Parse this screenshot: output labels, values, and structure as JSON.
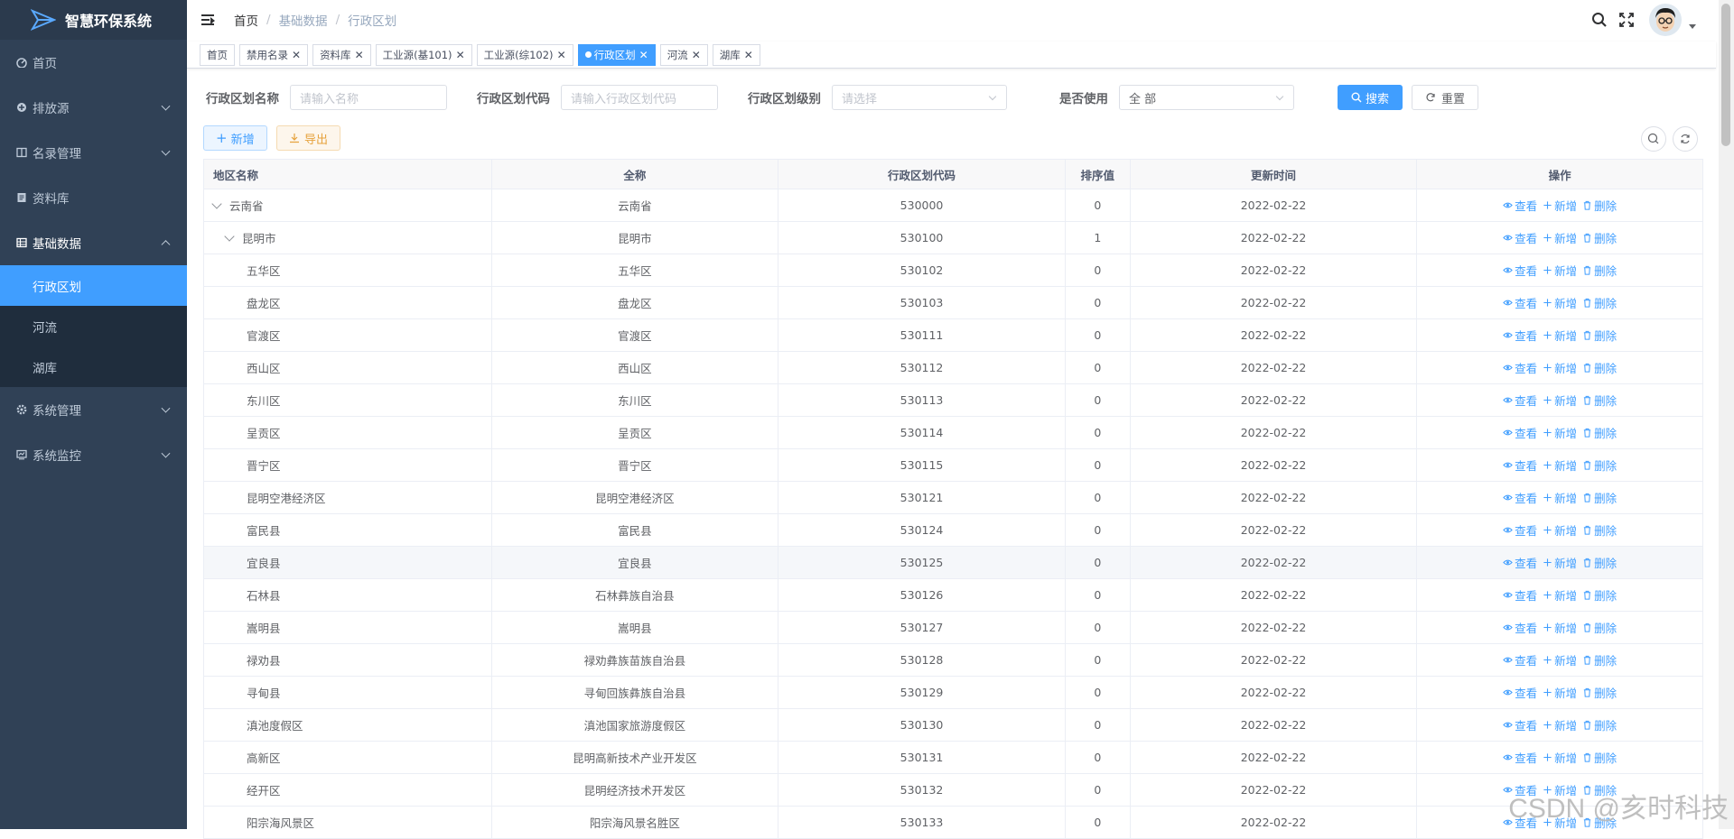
{
  "app": {
    "title": "智慧环保系统"
  },
  "sidebar": {
    "items": [
      {
        "label": "首页",
        "icon": "dashboard-icon"
      },
      {
        "label": "排放源",
        "icon": "emission-icon"
      },
      {
        "label": "名录管理",
        "icon": "directory-icon"
      },
      {
        "label": "资料库",
        "icon": "document-icon"
      },
      {
        "label": "基础数据",
        "icon": "grid-icon"
      },
      {
        "label": "系统管理",
        "icon": "gear-icon"
      },
      {
        "label": "系统监控",
        "icon": "monitor-icon"
      }
    ],
    "sub_items": [
      "行政区划",
      "河流",
      "湖库"
    ]
  },
  "breadcrumb": [
    "首页",
    "基础数据",
    "行政区划"
  ],
  "tags": [
    "首页",
    "禁用名录",
    "资料库",
    "工业源(基101)",
    "工业源(综102)",
    "行政区划",
    "河流",
    "湖库"
  ],
  "form": {
    "name_label": "行政区划名称",
    "name_placeholder": "请输入名称",
    "code_label": "行政区划代码",
    "code_placeholder": "请输入行政区划代码",
    "level_label": "行政区划级别",
    "level_placeholder": "请选择",
    "use_label": "是否使用",
    "use_value": "全 部",
    "search_label": "搜索",
    "reset_label": "重置"
  },
  "toolbar": {
    "add_label": "新增",
    "export_label": "导出"
  },
  "table": {
    "headers": [
      "地区名称",
      "全称",
      "行政区划代码",
      "排序值",
      "更新时间",
      "操作"
    ],
    "ops": [
      "查看",
      "新增",
      "删除"
    ],
    "rows": [
      {
        "name": "云南省",
        "full": "云南省",
        "code": "530000",
        "sort": "0",
        "time": "2022-02-22",
        "level": 0
      },
      {
        "name": "昆明市",
        "full": "昆明市",
        "code": "530100",
        "sort": "1",
        "time": "2022-02-22",
        "level": 1
      },
      {
        "name": "五华区",
        "full": "五华区",
        "code": "530102",
        "sort": "0",
        "time": "2022-02-22",
        "level": 2
      },
      {
        "name": "盘龙区",
        "full": "盘龙区",
        "code": "530103",
        "sort": "0",
        "time": "2022-02-22",
        "level": 2
      },
      {
        "name": "官渡区",
        "full": "官渡区",
        "code": "530111",
        "sort": "0",
        "time": "2022-02-22",
        "level": 2
      },
      {
        "name": "西山区",
        "full": "西山区",
        "code": "530112",
        "sort": "0",
        "time": "2022-02-22",
        "level": 2
      },
      {
        "name": "东川区",
        "full": "东川区",
        "code": "530113",
        "sort": "0",
        "time": "2022-02-22",
        "level": 2
      },
      {
        "name": "呈贡区",
        "full": "呈贡区",
        "code": "530114",
        "sort": "0",
        "time": "2022-02-22",
        "level": 2
      },
      {
        "name": "晋宁区",
        "full": "晋宁区",
        "code": "530115",
        "sort": "0",
        "time": "2022-02-22",
        "level": 2
      },
      {
        "name": "昆明空港经济区",
        "full": "昆明空港经济区",
        "code": "530121",
        "sort": "0",
        "time": "2022-02-22",
        "level": 2
      },
      {
        "name": "富民县",
        "full": "富民县",
        "code": "530124",
        "sort": "0",
        "time": "2022-02-22",
        "level": 2
      },
      {
        "name": "宜良县",
        "full": "宜良县",
        "code": "530125",
        "sort": "0",
        "time": "2022-02-22",
        "level": 2
      },
      {
        "name": "石林县",
        "full": "石林彝族自治县",
        "code": "530126",
        "sort": "0",
        "time": "2022-02-22",
        "level": 2
      },
      {
        "name": "嵩明县",
        "full": "嵩明县",
        "code": "530127",
        "sort": "0",
        "time": "2022-02-22",
        "level": 2
      },
      {
        "name": "禄劝县",
        "full": "禄劝彝族苗族自治县",
        "code": "530128",
        "sort": "0",
        "time": "2022-02-22",
        "level": 2
      },
      {
        "name": "寻甸县",
        "full": "寻甸回族彝族自治县",
        "code": "530129",
        "sort": "0",
        "time": "2022-02-22",
        "level": 2
      },
      {
        "name": "滇池度假区",
        "full": "滇池国家旅游度假区",
        "code": "530130",
        "sort": "0",
        "time": "2022-02-22",
        "level": 2
      },
      {
        "name": "高新区",
        "full": "昆明高新技术产业开发区",
        "code": "530131",
        "sort": "0",
        "time": "2022-02-22",
        "level": 2
      },
      {
        "name": "经开区",
        "full": "昆明经济技术开发区",
        "code": "530132",
        "sort": "0",
        "time": "2022-02-22",
        "level": 2
      },
      {
        "name": "阳宗海风景区",
        "full": "阳宗海风景名胜区",
        "code": "530133",
        "sort": "0",
        "time": "2022-02-22",
        "level": 2
      }
    ]
  },
  "watermark": "CSDN @亥时科技",
  "colors": {
    "sidebar": "#304156",
    "submenu": "#1f2d3d",
    "accent": "#409eff",
    "warning": "#e6a23c"
  }
}
